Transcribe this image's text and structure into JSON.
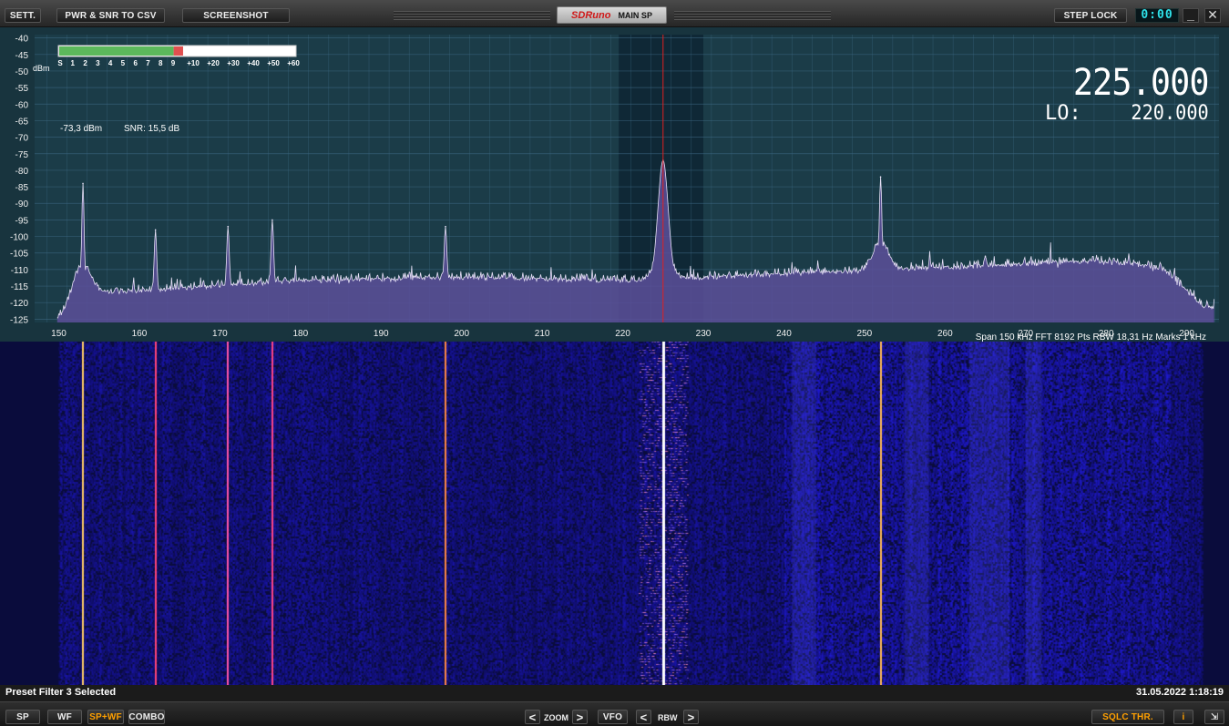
{
  "toolbar": {
    "settings_label": "SETT.",
    "pwr_snr_label": "PWR & SNR TO CSV",
    "screenshot_label": "SCREENSHOT",
    "step_lock_label": "STEP LOCK"
  },
  "title": {
    "app_logo": "SDRuno",
    "window_name": "MAIN SP"
  },
  "clock_display": "0:00",
  "window_buttons": {
    "minimize": "_",
    "close": "✕"
  },
  "readouts": {
    "frequency": "225.000",
    "lo_label": "LO:",
    "lo_value": "220.000",
    "power": "-73,3 dBm",
    "snr": "SNR: 15,5 dB",
    "dbm_unit": "dBm",
    "span_info": "Span 150 kHz   FFT 8192 Pts   RBW 18,31 Hz   Marks 1 kHz"
  },
  "s_meter": {
    "scale": [
      "S",
      "1",
      "2",
      "3",
      "4",
      "5",
      "6",
      "7",
      "8",
      "9",
      "+10",
      "+20",
      "+30",
      "+40",
      "+50",
      "+60"
    ],
    "level_fraction": 0.485,
    "over_fraction": 0.04,
    "green": "#5cb85c",
    "red": "#e05050"
  },
  "chart_data": {
    "type": "area",
    "y_ticks": [
      -40,
      -45,
      -50,
      -55,
      -60,
      -65,
      -70,
      -75,
      -80,
      -85,
      -90,
      -95,
      -100,
      -105,
      -110,
      -115,
      -120,
      -125
    ],
    "x_ticks": [
      150,
      160,
      170,
      180,
      190,
      200,
      210,
      220,
      230,
      240,
      250,
      260,
      270,
      280,
      290
    ],
    "xlim": [
      147,
      294
    ],
    "ylim": [
      -126,
      -39
    ],
    "xlabel": "",
    "ylabel": "dBm",
    "grid": true,
    "center_marker": 225,
    "filter_band": [
      219.5,
      230
    ],
    "peaks": [
      {
        "x": 153,
        "y": -84
      },
      {
        "x": 162,
        "y": -98
      },
      {
        "x": 171,
        "y": -97
      },
      {
        "x": 176.5,
        "y": -95
      },
      {
        "x": 198,
        "y": -97
      },
      {
        "x": 225,
        "y": -77
      },
      {
        "x": 252,
        "y": -82
      },
      {
        "x": 265,
        "y": -106
      }
    ],
    "noise_floor": [
      {
        "x": 150,
        "y": -125
      },
      {
        "x": 152,
        "y": -118
      },
      {
        "x": 160,
        "y": -117
      },
      {
        "x": 180,
        "y": -114
      },
      {
        "x": 200,
        "y": -113
      },
      {
        "x": 220,
        "y": -114
      },
      {
        "x": 240,
        "y": -112
      },
      {
        "x": 260,
        "y": -110
      },
      {
        "x": 280,
        "y": -108
      },
      {
        "x": 287,
        "y": -110
      },
      {
        "x": 292,
        "y": -122
      }
    ],
    "colors": {
      "fill": "#5c4f9a",
      "trace": "#e6e0f5",
      "grid": "#3e6a86",
      "marker": "#e02020",
      "band": "#0f2836"
    }
  },
  "status": {
    "left": "Preset Filter 3 Selected",
    "right": "31.05.2022 1:18:19"
  },
  "bottombar": {
    "sp": "SP",
    "wf": "WF",
    "spwf": "SP+WF",
    "combo": "COMBO",
    "zoom": "ZOOM",
    "vfo": "VFO",
    "rbw": "RBW",
    "sqlc": "SQLC THR.",
    "info": "i",
    "left_arrow": "<",
    "right_arrow": ">",
    "resize": "⇲"
  },
  "waterfall": {
    "lines": [
      {
        "x": 153,
        "color": "#ffcc66"
      },
      {
        "x": 162,
        "color": "#ff4477"
      },
      {
        "x": 171,
        "color": "#ff55aa"
      },
      {
        "x": 176.5,
        "color": "#ff4488"
      },
      {
        "x": 198,
        "color": "#ff8844"
      },
      {
        "x": 225,
        "color": "#ffffff"
      },
      {
        "x": 252,
        "color": "#ffbb55"
      }
    ]
  }
}
